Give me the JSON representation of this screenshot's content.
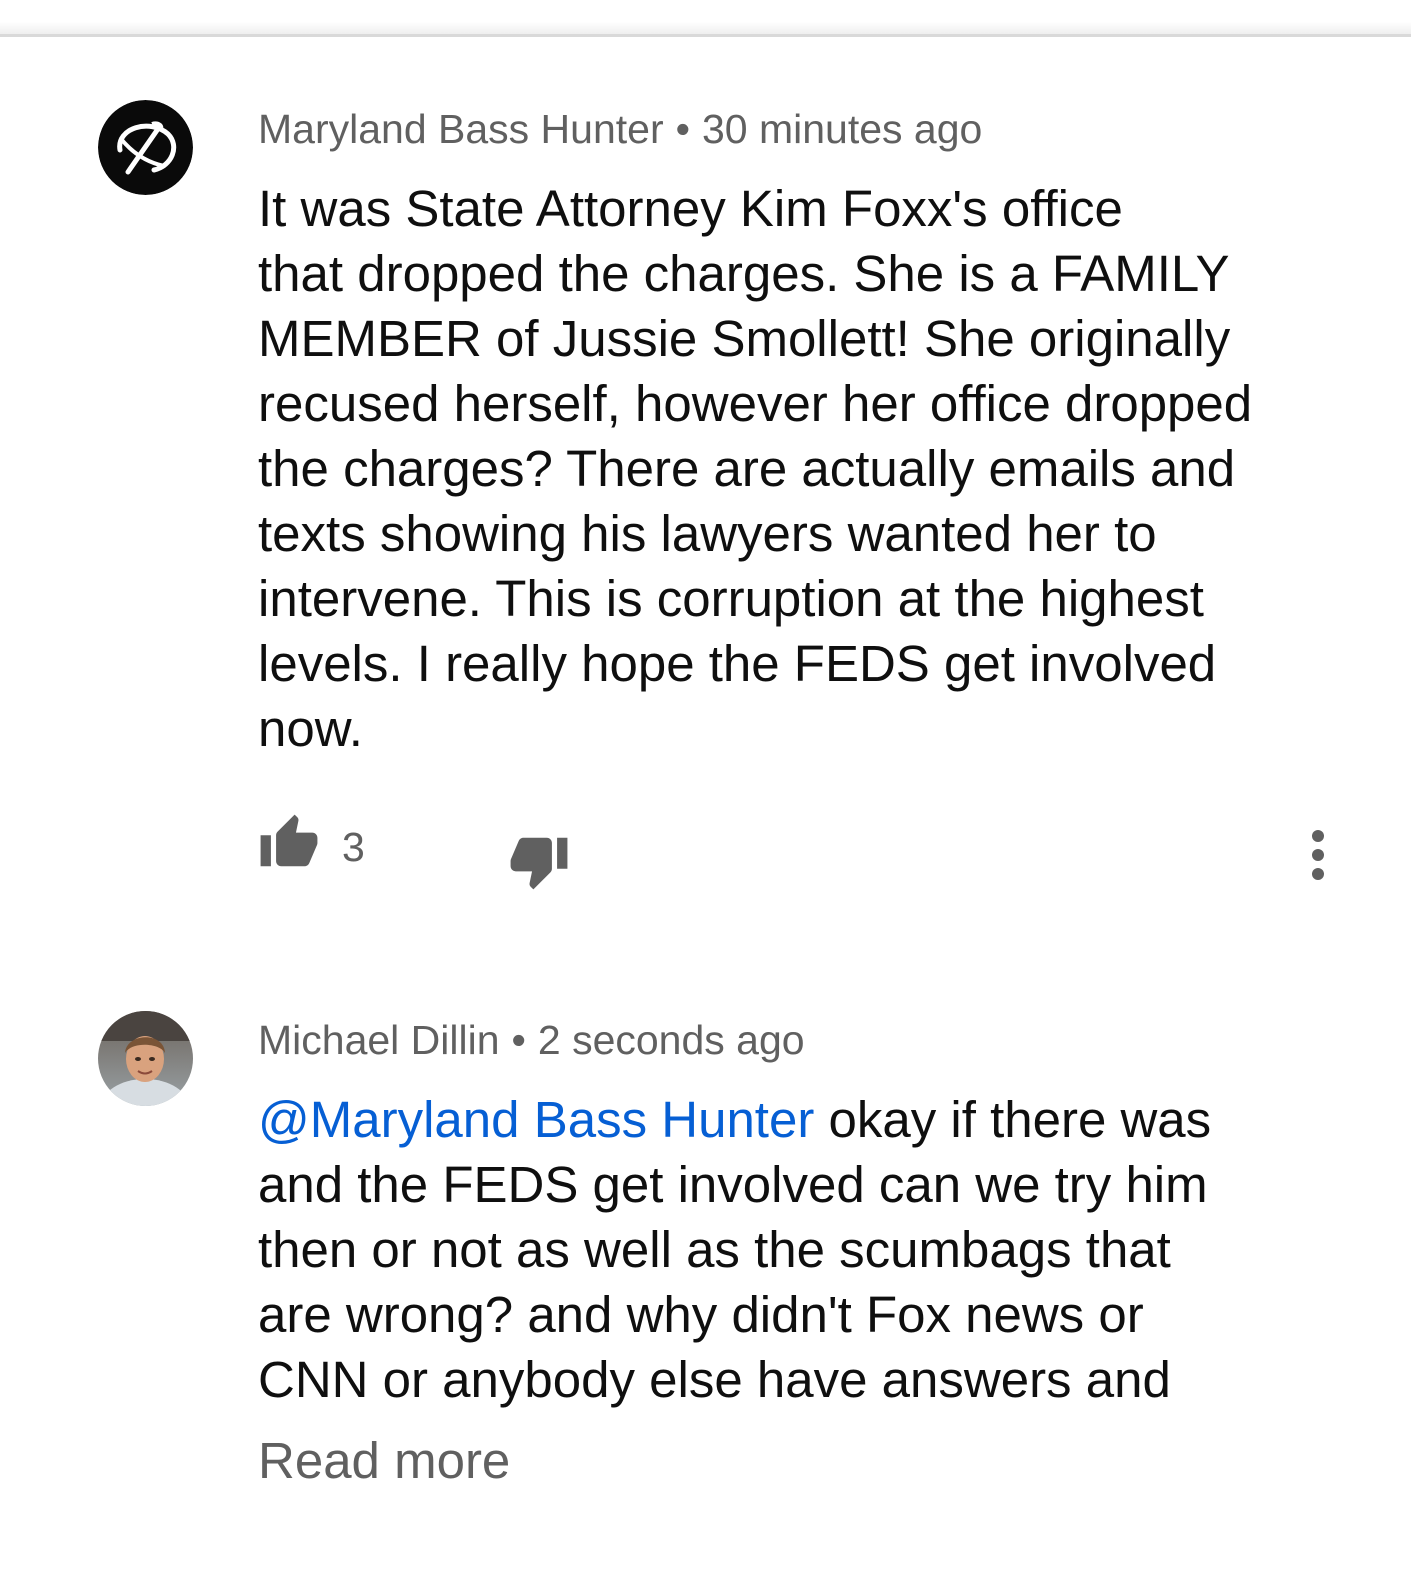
{
  "comments": [
    {
      "author": "Maryland Bass Hunter",
      "separator": "•",
      "time": "30 minutes ago",
      "avatar_icon": "black-circle-logo-avatar",
      "text": "It was State Attorney Kim Foxx's office\nthat dropped the charges.  She is a FAMILY\nMEMBER of Jussie Smollett!  She originally\nrecused herself, however her office dropped\nthe charges?  There are actually emails and\ntexts showing his lawyers wanted her to\nintervene.  This is corruption at the highest\nlevels.  I really hope the FEDS get involved\nnow.",
      "likes": "3",
      "like_icon": "thumbs-up-icon",
      "dislike_icon": "thumbs-down-icon",
      "more_icon": "more-vertical-icon"
    },
    {
      "author": "Michael Dillin",
      "separator": "•",
      "time": "2 seconds ago",
      "avatar_icon": "profile-photo-avatar",
      "mention": "@Maryland Bass Hunter",
      "text": " okay if there was\nand the FEDS get involved can we try him\nthen or not as well as the scumbags that\nare wrong? and why didn't Fox news or\nCNN or anybody else have answers and",
      "read_more": "Read more"
    }
  ],
  "colors": {
    "meta": "#606060",
    "text": "#0f0f0f",
    "mention": "#065fd4",
    "icon": "#606060"
  }
}
